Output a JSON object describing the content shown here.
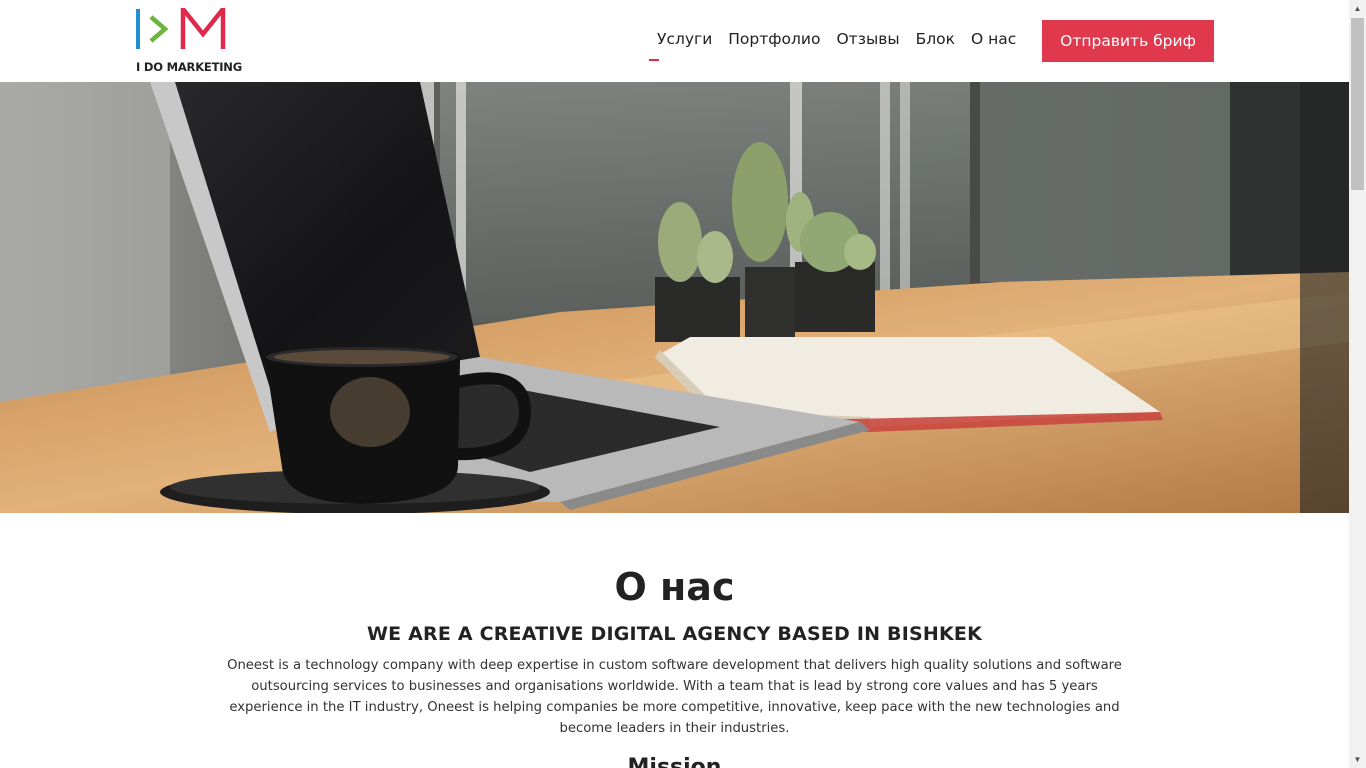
{
  "header": {
    "logo_text": "I DO MARKETING",
    "nav": [
      {
        "label": "Услуги",
        "active": true
      },
      {
        "label": "Портфолио",
        "active": false
      },
      {
        "label": "Отзывы",
        "active": false
      },
      {
        "label": "Блок",
        "active": false
      },
      {
        "label": "О нас",
        "active": false
      }
    ],
    "cta_label": "Отправить бриф"
  },
  "about": {
    "title": "О нас",
    "subtitle": "WE ARE A CREATIVE DIGITAL AGENCY BASED IN BISHKEK",
    "text": "Oneest is a technology company with deep expertise in custom software development that delivers high quality solutions and software outsourcing services to businesses and organisations worldwide. With a team that is lead by strong core values and has 5 years experience in the IT industry, Oneest is helping companies be more competitive, innovative, keep pace with the new technologies and become leaders in their industries.",
    "mission_title": "Mission"
  },
  "colors": {
    "accent": "#e0384c",
    "logo_blue": "#1e8fd0",
    "logo_green": "#6cb33f",
    "logo_red": "#e0284b"
  },
  "icons": {
    "logo": "i-do-marketing-logo",
    "scroll_up": "triangle-up-icon",
    "scroll_down": "triangle-down-icon"
  }
}
